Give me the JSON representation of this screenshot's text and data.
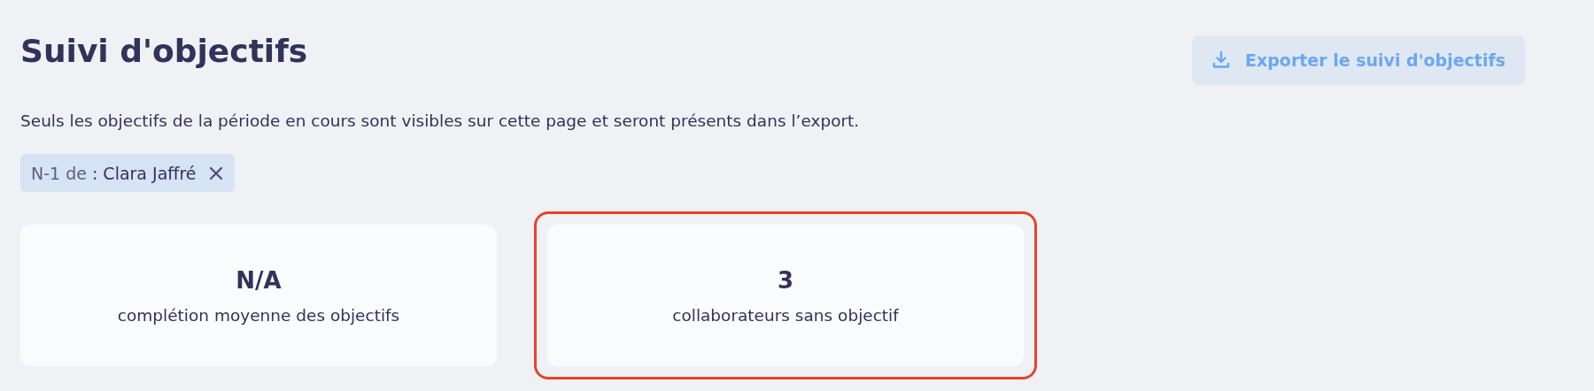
{
  "header": {
    "title": "Suivi d'objectifs",
    "export_button": {
      "label": "Exporter le suivi d'objectifs",
      "disabled": true
    }
  },
  "notice": "Seuls les objectifs de la période en cours sont visibles sur cette page et seront présents dans l’export.",
  "filters": [
    {
      "name": "N-1 de",
      "separator": ":",
      "value": "Clara Jaffré"
    }
  ],
  "stats": [
    {
      "value": "N/A",
      "label": "complétion moyenne des objectifs",
      "highlighted": false
    },
    {
      "value": "3",
      "label": "collaborateurs sans objectif",
      "highlighted": true
    }
  ]
}
